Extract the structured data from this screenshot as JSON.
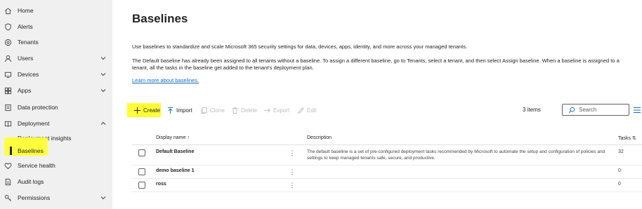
{
  "sidebar": {
    "items": [
      {
        "label": "Home",
        "icon": "home-icon"
      },
      {
        "label": "Alerts",
        "icon": "shield-icon"
      },
      {
        "label": "Tenants",
        "icon": "tenants-icon"
      },
      {
        "label": "Users",
        "icon": "person-icon"
      },
      {
        "label": "Devices",
        "icon": "devices-icon"
      },
      {
        "label": "Apps",
        "icon": "apps-icon"
      },
      {
        "label": "Data protection",
        "icon": "data-protection-icon"
      },
      {
        "label": "Deployment",
        "icon": "book-icon"
      },
      {
        "label": "Deployment insights"
      },
      {
        "label": "Baselines"
      },
      {
        "label": "Service health",
        "icon": "heart-icon"
      },
      {
        "label": "Audit logs",
        "icon": "document-icon"
      },
      {
        "label": "Permissions",
        "icon": "key-icon"
      }
    ]
  },
  "page": {
    "title": "Baselines",
    "intro": "Use baselines to standardize and scale Microsoft 365 security settings for data, devices, apps, identity, and more across your managed tenants.",
    "detail": "The Default baseline has already been assigned to all tenants without a baseline. To assign a different baseline, go to Tenants, select a tenant, and then select Assign baseline. When a baseline is assigned to a tenant, all the tasks in the baseline get added to the tenant's deployment plan.",
    "learn_more": "Learn more about baselines."
  },
  "toolbar": {
    "create": "Create",
    "import": "Import",
    "clone": "Clone",
    "delete": "Delete",
    "export": "Export",
    "edit": "Edit",
    "count": "3 items",
    "search_placeholder": "Search"
  },
  "table": {
    "headers": {
      "name": "Display name ↑",
      "description": "Description",
      "tasks": "Tasks ⇅"
    },
    "rows": [
      {
        "name": "Default Baseline",
        "description": "The default baseline is a set of pre-configured deployment tasks recommended by Microsoft to automate the setup and configuration of policies and settings to keep managed tenants safe, secure, and productive.",
        "tasks": "32"
      },
      {
        "name": "demo baseline 1",
        "description": "",
        "tasks": "0"
      },
      {
        "name": "ross",
        "description": "",
        "tasks": "0"
      }
    ]
  },
  "colors": {
    "highlight": "#ffff33",
    "link": "#0f6cbd",
    "sidebar_bg": "#f0f0f0"
  }
}
